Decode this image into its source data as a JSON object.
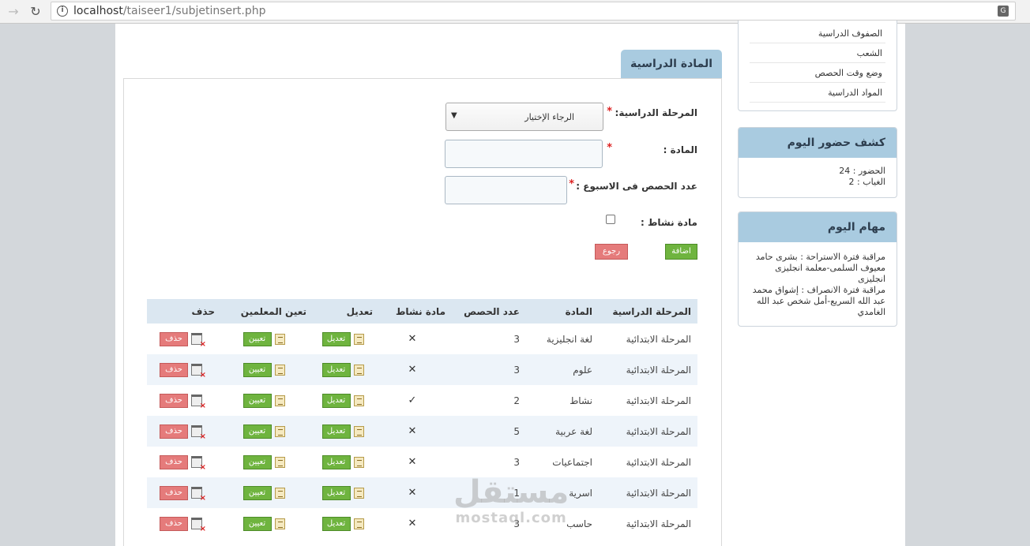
{
  "browser": {
    "url_host": "localhost",
    "url_path": "/taiseer1/subjetinsert.php"
  },
  "panel": {
    "title": "المادة الدراسية"
  },
  "form": {
    "stage_label": "المرحلة الدراسية:",
    "stage_select_value": "الرجاء الإختيار",
    "subject_label": "المادة :",
    "periods_label": "عدد الحصص فى الاسبوع :",
    "activity_label": "مادة نشاط :",
    "add_button": "اضافة",
    "back_button": "رجوع",
    "required_mark": "*"
  },
  "table": {
    "headers": [
      "المرحلة الدراسية",
      "المادة",
      "عدد الحصص",
      "مادة نشاط",
      "تعديل",
      "تعين المعلمين",
      "حذف"
    ],
    "edit_label": "تعديل",
    "assign_label": "تعيين",
    "delete_label": "حذف",
    "rows": [
      {
        "stage": "المرحلة الابتدائية",
        "subject": "لغة انجليزية",
        "periods": "3",
        "activity": "✕"
      },
      {
        "stage": "المرحلة الابتدائية",
        "subject": "علوم",
        "periods": "3",
        "activity": "✕"
      },
      {
        "stage": "المرحلة الابتدائية",
        "subject": "نشاط",
        "periods": "2",
        "activity": "✓"
      },
      {
        "stage": "المرحلة الابتدائية",
        "subject": "لغة عربية",
        "periods": "5",
        "activity": "✕"
      },
      {
        "stage": "المرحلة الابتدائية",
        "subject": "اجتماعيات",
        "periods": "3",
        "activity": "✕"
      },
      {
        "stage": "المرحلة الابتدائية",
        "subject": "اسرية",
        "periods": "1",
        "activity": "✕"
      },
      {
        "stage": "المرحلة الابتدائية",
        "subject": "حاسب",
        "periods": "3",
        "activity": "✕"
      }
    ]
  },
  "sidebar": {
    "links": [
      "الصفوف الدراسية",
      "الشعب",
      "وضع وقت الحصص",
      "المواد الدراسية"
    ],
    "attendance": {
      "title": "كشف حضور اليوم",
      "present": "الحضور : 24",
      "absent": "الغياب : 2"
    },
    "tasks": {
      "title": "مهام اليوم",
      "lines": [
        "مراقبة فترة الاستراحة : بشرى حامد معيوف السلمى-معلمة انجليزى انجليزى",
        "مراقبة فترة الانصراف : إشواق محمد عبد الله السريع-أمل شخص عبد الله الغامدي"
      ]
    }
  },
  "watermark": {
    "arabic": "مستقل",
    "latin": "mostaql.com"
  }
}
